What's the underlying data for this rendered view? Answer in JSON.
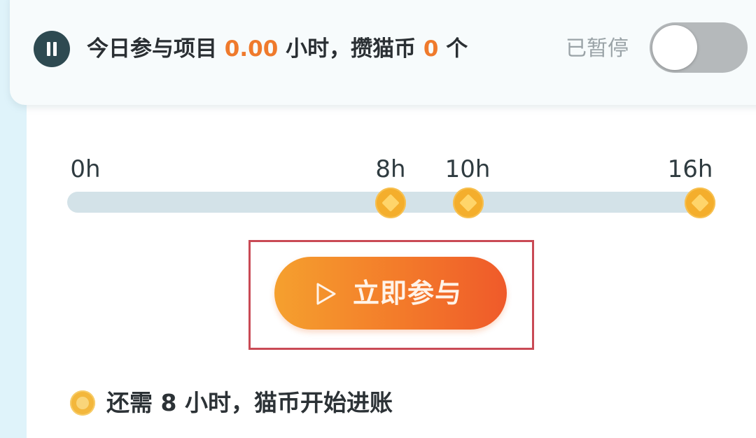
{
  "status": {
    "prefix": "今日参与项目 ",
    "hours_value": "0.00",
    "hours_unit": " 小时，攒猫币 ",
    "coins_value": "0",
    "coins_unit": " 个",
    "paused_label": "已暂停",
    "toggle_on": false
  },
  "timeline": {
    "ticks": [
      "0h",
      "8h",
      "10h",
      "16h"
    ],
    "milestones": [
      "8h",
      "10h",
      "16h"
    ]
  },
  "join": {
    "label": "立即参与"
  },
  "footer": {
    "remaining_text": "还需 8 小时，猫币开始进账"
  },
  "colors": {
    "accent_orange": "#ef7a2c",
    "button_gradient_start": "#f5a02e",
    "button_gradient_end": "#ef5a2a",
    "milestone_gold": "#f4ae2c",
    "highlight_red": "#c94a55",
    "pause_icon_dark": "#2e4a51"
  },
  "icons": {
    "pause": "pause-icon",
    "play": "play-icon",
    "milestone": "milestone-icon",
    "coin": "coin-icon"
  }
}
